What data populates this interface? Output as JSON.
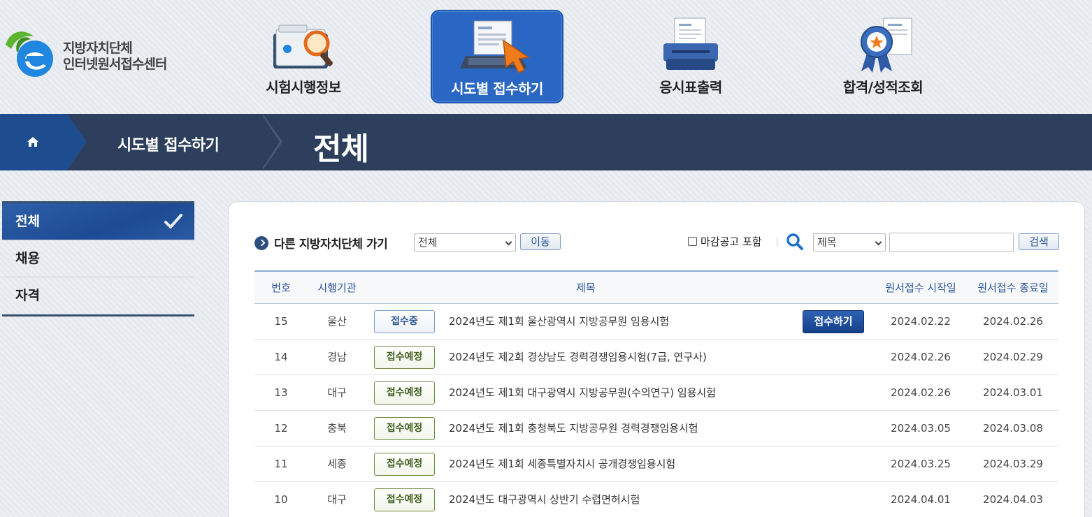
{
  "brand": {
    "name_line1": "지방자치단체",
    "name_line2": "인터넷원서접수센터",
    "colors": {
      "logo_green": "#5cb531",
      "logo_blue": "#1f87e0"
    }
  },
  "nav": [
    {
      "label": "시험시행정보",
      "icon": "folder-magnifier-icon",
      "active": false
    },
    {
      "label": "시도별 접수하기",
      "icon": "laptop-cursor-icon",
      "active": true
    },
    {
      "label": "응시표출력",
      "icon": "printer-icon",
      "active": false
    },
    {
      "label": "합격/성적조회",
      "icon": "award-ribbon-icon",
      "active": false
    }
  ],
  "breadcrumb": {
    "home_icon": "home-icon",
    "level1": "시도별 접수하기",
    "current": "전체"
  },
  "sidebar": {
    "items": [
      {
        "label": "전체",
        "active": true
      },
      {
        "label": "채용",
        "active": false
      },
      {
        "label": "자격",
        "active": false
      }
    ]
  },
  "toolbar": {
    "go_label": "다른 지방자치단체 가기",
    "region_select_value": "전체",
    "move_button": "이동",
    "include_closed_label": "마감공고 포함",
    "search_field_select_value": "제목",
    "search_input_value": "",
    "search_button": "검색"
  },
  "table": {
    "headers": [
      "번호",
      "시행기관",
      "제목",
      "원서접수 시작일",
      "원서접수 종료일"
    ],
    "apply_button": "접수하기",
    "rows": [
      {
        "no": "15",
        "org": "울산",
        "status": "접수중",
        "status_type": "open",
        "title": "2024년도 제1회 울산광역시 지방공무원 임용시험",
        "start": "2024.02.22",
        "end": "2024.02.26",
        "apply": true
      },
      {
        "no": "14",
        "org": "경남",
        "status": "접수예정",
        "status_type": "soon",
        "title": "2024년도 제2회 경상남도 경력경쟁임용시험(7급, 연구사)",
        "start": "2024.02.26",
        "end": "2024.02.29",
        "apply": false
      },
      {
        "no": "13",
        "org": "대구",
        "status": "접수예정",
        "status_type": "soon",
        "title": "2024년도 제1회 대구광역시 지방공무원(수의연구) 임용시험",
        "start": "2024.02.26",
        "end": "2024.03.01",
        "apply": false
      },
      {
        "no": "12",
        "org": "충북",
        "status": "접수예정",
        "status_type": "soon",
        "title": "2024년도 제1회 충청북도 지방공무원 경력경쟁임용시험",
        "start": "2024.03.05",
        "end": "2024.03.08",
        "apply": false
      },
      {
        "no": "11",
        "org": "세종",
        "status": "접수예정",
        "status_type": "soon",
        "title": "2024년도 제1회 세종특별자치시 공개경쟁임용시험",
        "start": "2024.03.25",
        "end": "2024.03.29",
        "apply": false
      },
      {
        "no": "10",
        "org": "대구",
        "status": "접수예정",
        "status_type": "soon",
        "title": "2024년도 대구광역시 상반기 수렵면허시험",
        "start": "2024.04.01",
        "end": "2024.04.03",
        "apply": false
      }
    ]
  }
}
